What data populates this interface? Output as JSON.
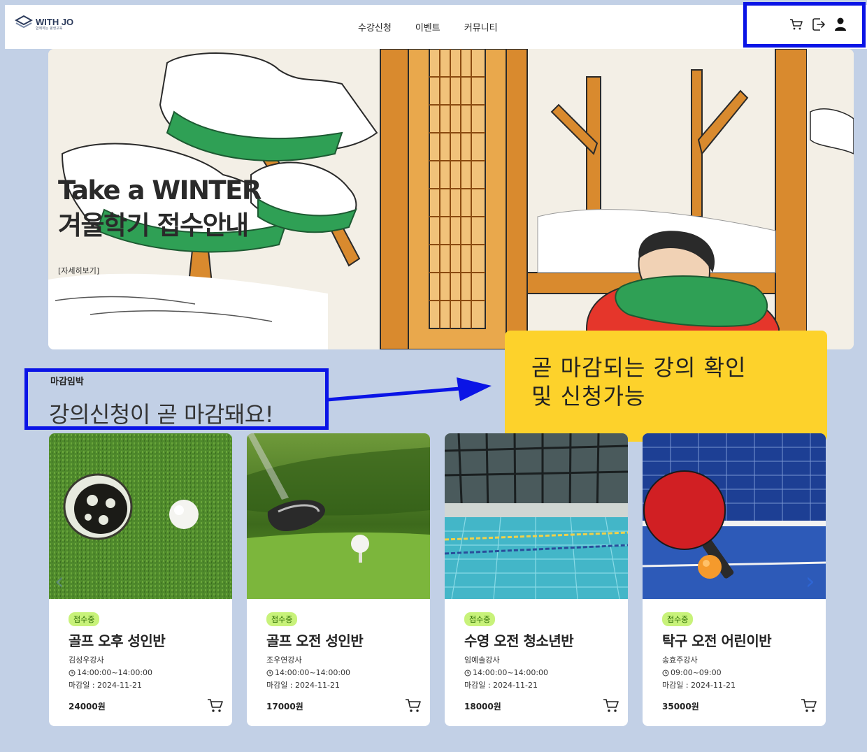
{
  "header": {
    "logo_text": "WITH JO",
    "logo_sub": "함께하는 평생교육",
    "nav": [
      "수강신청",
      "이벤트",
      "커뮤니티"
    ]
  },
  "hero": {
    "title_line1": "Take a WINTER",
    "title_line2": "겨울학기 접수안내",
    "link": "[자세히보기]"
  },
  "section": {
    "label": "마감임박",
    "title": "강의신청이 곧 마감돼요!"
  },
  "callout": {
    "line1": "곧 마감되는 강의 확인",
    "line2": "및 신청가능"
  },
  "cards": [
    {
      "badge": "접수중",
      "title": "골프 오후 성인반",
      "teacher": "김성우강사",
      "time": "14:00:00~14:00:00",
      "deadline": "마감일 : 2024-11-21",
      "price": "24000원"
    },
    {
      "badge": "접수중",
      "title": "골프 오전 성인반",
      "teacher": "조우연강사",
      "time": "14:00:00~14:00:00",
      "deadline": "마감일 : 2024-11-21",
      "price": "17000원"
    },
    {
      "badge": "접수중",
      "title": "수영 오전 청소년반",
      "teacher": "임예솔강사",
      "time": "14:00:00~14:00:00",
      "deadline": "마감일 : 2024-11-21",
      "price": "18000원"
    },
    {
      "badge": "접수중",
      "title": "탁구 오전 어린이반",
      "teacher": "송효주강사",
      "time": "09:00~09:00",
      "deadline": "마감일 : 2024-11-21",
      "price": "35000원"
    }
  ],
  "colors": {
    "background": "#c2d0e6",
    "annotation_blue": "#0a14e6",
    "callout_yellow": "#fdd22b",
    "badge_green": "#c8f27a"
  },
  "icons": [
    "logo-icon",
    "cart-icon",
    "logout-icon",
    "user-icon",
    "clock-icon",
    "chevron-left-icon",
    "chevron-right-icon"
  ]
}
